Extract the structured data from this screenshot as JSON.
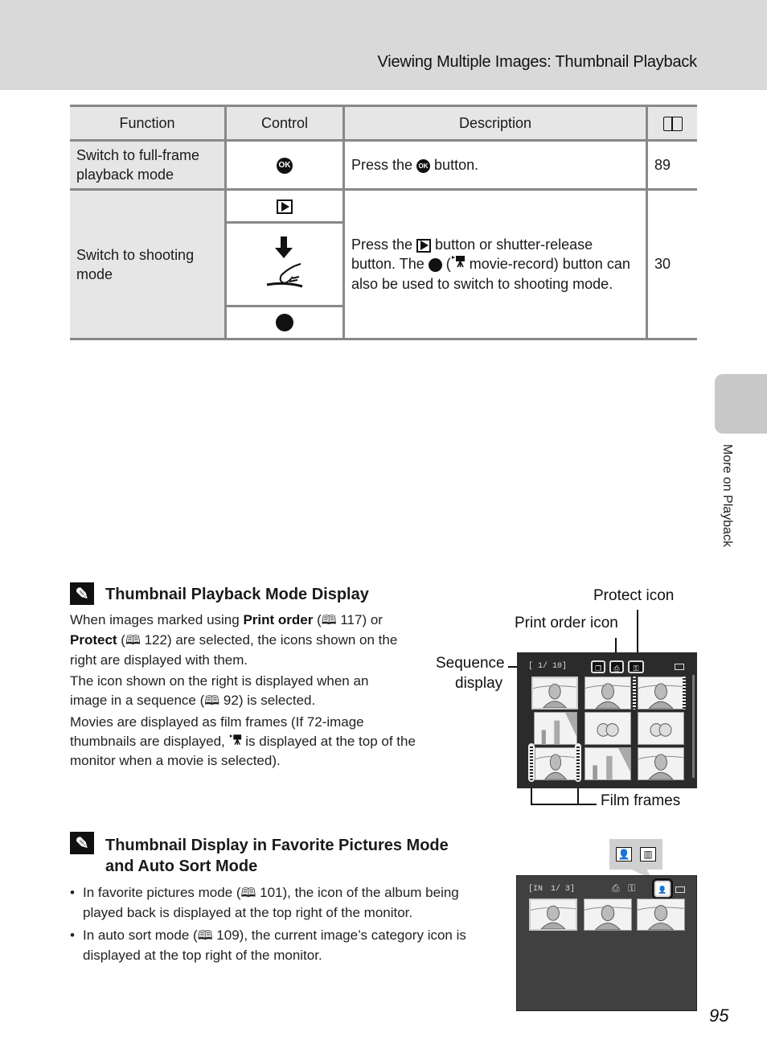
{
  "header": {
    "title": "Viewing Multiple Images: Thumbnail Playback"
  },
  "side_tab": {
    "label": "More on Playback"
  },
  "table": {
    "headers": {
      "function": "Function",
      "control": "Control",
      "description": "Description",
      "page": "🕮"
    },
    "rows": [
      {
        "function": "Switch to full-frame playback mode",
        "control_icons": [
          "ok-button-icon"
        ],
        "desc_parts": [
          "Press the ",
          " button."
        ],
        "page": "89"
      },
      {
        "function": "Switch to shooting mode",
        "control_icons": [
          "playback-button-icon",
          "shutter-release-icon",
          "movie-record-icon"
        ],
        "desc_parts": [
          "Press the ",
          " button or shutter-release button. The ",
          " (",
          " movie-record) button can also be used to switch to shooting mode."
        ],
        "page": "30"
      }
    ],
    "ok_label": "OK"
  },
  "note1": {
    "title": "Thumbnail Playback Mode Display",
    "p1": {
      "a": "When images marked using ",
      "b1": "Print order",
      "c": " (",
      "ref1": "117",
      "d": ") or ",
      "b2": "Protect",
      "e": " (",
      "ref2": "122",
      "f": ") are selected, the icons shown on the right are displayed with them."
    },
    "p2": {
      "a": "The icon shown on the right is displayed when an image in a sequence (",
      "ref": "92",
      "b": ") is selected."
    },
    "p3": {
      "a": "Movies are displayed as film frames (If 72-image thumbnails are displayed, ",
      "b": " is displayed at the top of the monitor when a movie is selected)."
    },
    "callouts": {
      "protect": "Protect icon",
      "print_order": "Print order icon",
      "sequence_1": "Sequence",
      "sequence_2": "display",
      "film": "Film frames"
    },
    "screen": {
      "counter": "[  1/  10]"
    }
  },
  "note2": {
    "title_1": "Thumbnail Display in Favorite Pictures Mode",
    "title_2": "and Auto Sort Mode",
    "bullets": [
      {
        "a": "In favorite pictures mode (",
        "ref": "101",
        "b": "), the icon of the album being played back is displayed at the top right of the monitor."
      },
      {
        "a": "In auto sort mode (",
        "ref": "109",
        "b": "), the current image’s category icon is displayed at the top right of the monitor."
      }
    ],
    "screen": {
      "counter_prefix": "[IN",
      "counter": "1/    3]"
    }
  },
  "book_glyph": "🕮",
  "page_number": "95"
}
